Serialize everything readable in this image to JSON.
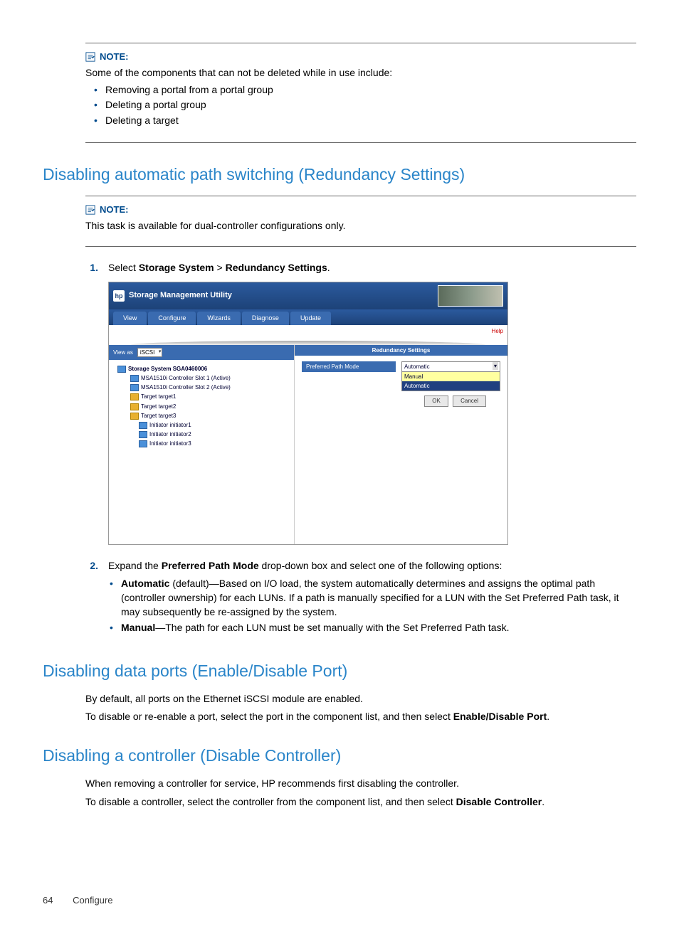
{
  "note1": {
    "label": "NOTE:",
    "text": "Some of the components that can not be deleted while in use include:",
    "bullets": [
      "Removing a portal from a portal group",
      "Deleting a portal group",
      "Deleting a target"
    ]
  },
  "section1": {
    "title": "Disabling automatic path switching (Redundancy Settings)"
  },
  "note2": {
    "label": "NOTE:",
    "text": "This task is available for dual-controller configurations only."
  },
  "steps": {
    "s1": {
      "num": "1.",
      "pre": "Select ",
      "b1": "Storage System",
      "sep": " > ",
      "b2": "Redundancy Settings",
      "post": "."
    },
    "s2": {
      "num": "2.",
      "pre": "Expand the ",
      "b1": "Preferred Path Mode",
      "post": " drop-down box and select one of the following options:",
      "opts": {
        "a": {
          "b": "Automatic",
          "t": " (default)—Based on I/O load, the system automatically determines and assigns the optimal path (controller ownership) for each LUNs. If a path is manually specified for a LUN with the Set Preferred Path task, it may subsequently be re-assigned by the system."
        },
        "m": {
          "b": "Manual",
          "t": "—The path for each LUN must be set manually with the Set Preferred Path task."
        }
      }
    }
  },
  "screenshot": {
    "title": "Storage Management Utility",
    "tabs": [
      "View",
      "Configure",
      "Wizards",
      "Diagnose",
      "Update"
    ],
    "view_label": "View as",
    "view_value": "iSCSI",
    "tree": {
      "root": "Storage System SGA0460006",
      "c1": "MSA1510i Controller Slot 1 (Active)",
      "c2": "MSA1510i Controller Slot 2 (Active)",
      "t1": "Target target1",
      "t2": "Target target2",
      "t3": "Target target3",
      "i1": "Initiator initiator1",
      "i2": "Initiator initiator2",
      "i3": "Initiator initiator3"
    },
    "help": "Help",
    "panel_title": "Redundancy Settings",
    "form_label": "Preferred Path Mode",
    "select_value": "Automatic",
    "opt1": "Manual",
    "opt2": "Automatic",
    "btn_ok": "OK",
    "btn_cancel": "Cancel"
  },
  "section2": {
    "title": "Disabling data ports (Enable/Disable Port)",
    "p1": "By default, all ports on the Ethernet iSCSI module are enabled.",
    "p2_pre": "To disable or re-enable a port, select the port in the component list, and then select ",
    "p2_b": "Enable/Disable Port",
    "p2_post": "."
  },
  "section3": {
    "title": "Disabling a controller (Disable Controller)",
    "p1": "When removing a controller for service, HP recommends first disabling the controller.",
    "p2_pre": "To disable a controller, select the controller from the component list, and then select ",
    "p2_b": "Disable Controller",
    "p2_post": "."
  },
  "footer": {
    "page": "64",
    "section": "Configure"
  }
}
